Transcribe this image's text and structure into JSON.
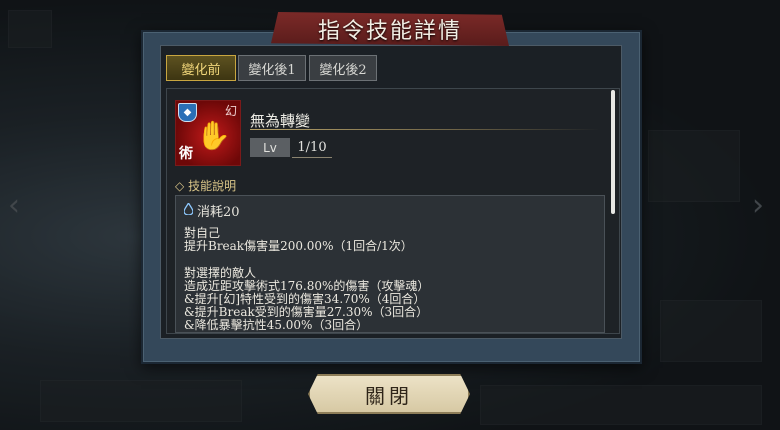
{
  "dialog": {
    "title": "指令技能詳情",
    "tabs": [
      {
        "label": "變化前",
        "active": true
      },
      {
        "label": "變化後1",
        "active": false
      },
      {
        "label": "變化後2",
        "active": false
      }
    ]
  },
  "skill": {
    "name": "無為轉變",
    "icon": {
      "badge_top_right": "幻",
      "badge_bottom_left": "術",
      "badge_icon": "shield-icon",
      "art": "skeletal-hand-icon"
    },
    "level_label": "Lv",
    "level_value": "1/10"
  },
  "description": {
    "section_title": "技能說明",
    "section_icon": "diamond-icon",
    "cost_icon": "water-drop-icon",
    "cost": "消耗20",
    "lines": [
      "對自己",
      "提升Break傷害量200.00%（1回合/1次）",
      "",
      "對選擇的敵人",
      "造成近距攻擊術式176.80%的傷害（攻擊魂）",
      "&提升[幻]特性受到的傷害34.70%（4回合）",
      "&提升Break受到的傷害量27.30%（3回合）",
      "&降低暴擊抗性45.00%（3回合）"
    ]
  },
  "buttons": {
    "close_label": "關閉"
  },
  "colors": {
    "accent_gold": "#c8a640",
    "title_red": "#7b2a28",
    "panel_bg": "#1e2226"
  }
}
